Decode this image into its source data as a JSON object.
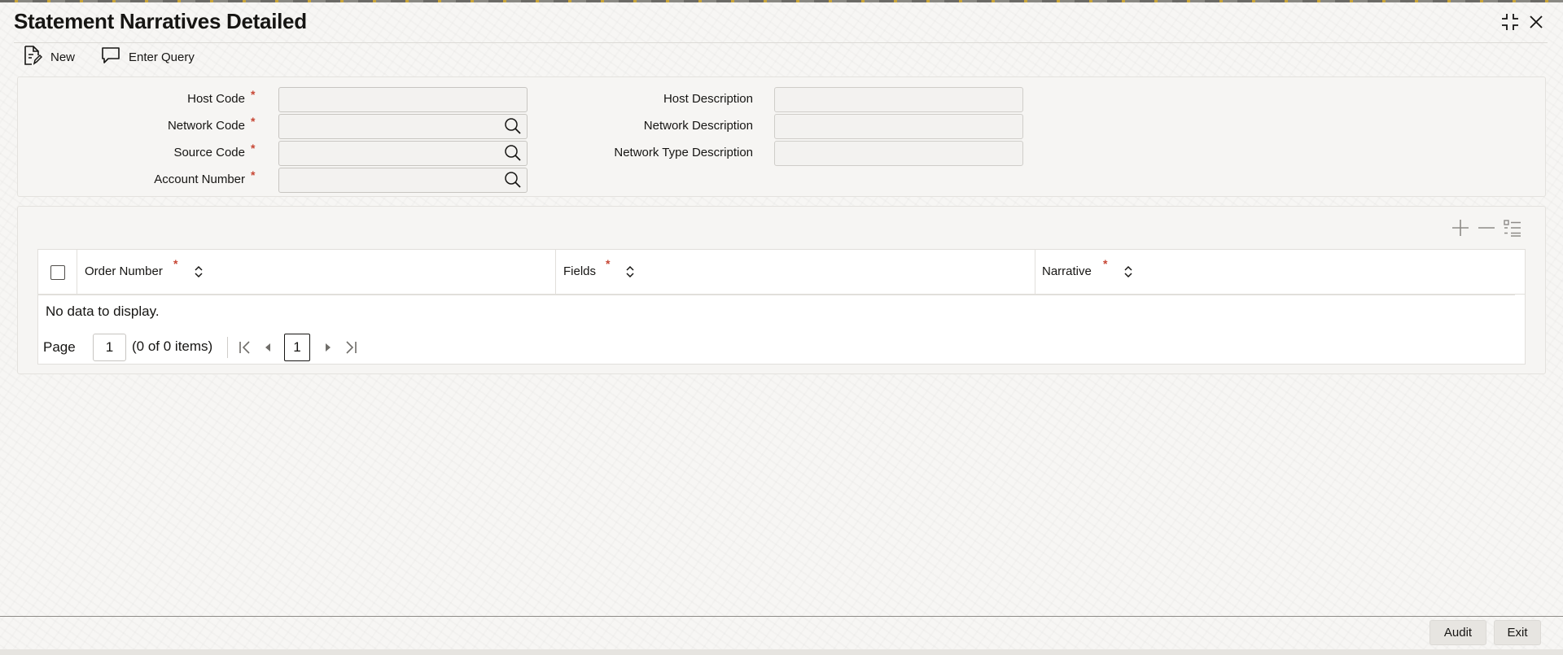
{
  "window": {
    "title": "Statement Narratives Detailed",
    "collapse_icon": "collapse-icon",
    "close_icon": "close-icon"
  },
  "toolbar": {
    "new_label": "New",
    "enter_query_label": "Enter Query"
  },
  "form": {
    "host_code": {
      "label": "Host Code",
      "required": "*",
      "value": ""
    },
    "network_code": {
      "label": "Network Code",
      "required": "*",
      "value": ""
    },
    "source_code": {
      "label": "Source Code",
      "required": "*",
      "value": ""
    },
    "account_number": {
      "label": "Account Number",
      "required": "*",
      "value": ""
    },
    "host_description": {
      "label": "Host Description",
      "value": ""
    },
    "network_description": {
      "label": "Network Description",
      "value": ""
    },
    "network_type_description": {
      "label": "Network Type Description",
      "value": ""
    }
  },
  "grid": {
    "columns": [
      {
        "label": "Order Number",
        "required": "*"
      },
      {
        "label": "Fields",
        "required": "*"
      },
      {
        "label": "Narrative",
        "required": "*"
      }
    ],
    "empty_text": "No data to display.",
    "pagination": {
      "page_label": "Page",
      "page_value": "1",
      "count_text": "(0 of 0 items)",
      "current_page": "1"
    }
  },
  "footer": {
    "audit_label": "Audit",
    "exit_label": "Exit"
  },
  "colors": {
    "required": "#c74634",
    "text": "#161513",
    "panel": "#f6f5f3"
  }
}
